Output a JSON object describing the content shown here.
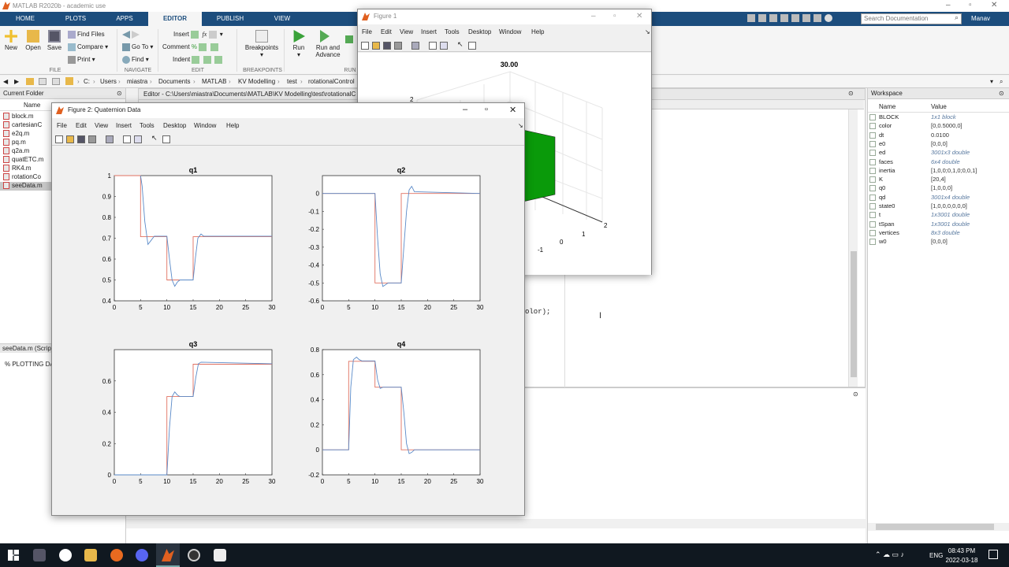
{
  "app": {
    "title": "MATLAB R2020b - academic use",
    "user": "Manav"
  },
  "ribbon": {
    "tabs": [
      "HOME",
      "PLOTS",
      "APPS",
      "EDITOR",
      "PUBLISH",
      "VIEW"
    ],
    "active_tab": "EDITOR",
    "file": {
      "new": "New",
      "open": "Open",
      "save": "Save",
      "find_files": "Find Files",
      "compare": "Compare",
      "print": "Print",
      "group": "FILE"
    },
    "navigate": {
      "go_to": "Go To",
      "find": "Find",
      "group": "NAVIGATE"
    },
    "edit": {
      "insert": "Insert",
      "comment": "Comment",
      "indent": "Indent",
      "group": "EDIT"
    },
    "breakpoints": {
      "label": "Breakpoints",
      "group": "BREAKPOINTS"
    },
    "run": {
      "run": "Run",
      "run_advance_1": "Run and",
      "run_advance_2": "Advance",
      "group": "RUN"
    }
  },
  "search": {
    "placeholder": "Search Documentation"
  },
  "path": [
    "C:",
    "Users",
    "miastra",
    "Documents",
    "MATLAB",
    "KV Modelling",
    "test",
    "rotationalControl"
  ],
  "current_folder": {
    "title": "Current Folder",
    "col_name": "Name",
    "files": [
      "block.m",
      "cartesianC",
      "e2q.m",
      "pq.m",
      "q2a.m",
      "quatETC.m",
      "RK4.m",
      "rotationCo",
      "seeData.m"
    ],
    "selected": "seeData.m",
    "details": "seeData.m  (Script)",
    "details_text": "% PLOTTING DAT"
  },
  "editor": {
    "title": "Editor - C:\\Users\\miastra\\Documents\\MATLAB\\KV Modelling\\test\\rotationalC",
    "code_fragment": "olor);"
  },
  "workspace": {
    "title": "Workspace",
    "col_name": "Name",
    "col_value": "Value",
    "vars": [
      {
        "name": "BLOCK",
        "value": "1x1 block",
        "italic": true
      },
      {
        "name": "color",
        "value": "[0,0.5000,0]",
        "italic": false
      },
      {
        "name": "dt",
        "value": "0.0100",
        "italic": false
      },
      {
        "name": "e0",
        "value": "[0,0,0]",
        "italic": false
      },
      {
        "name": "ed",
        "value": "3001x3 double",
        "italic": true
      },
      {
        "name": "faces",
        "value": "6x4 double",
        "italic": true
      },
      {
        "name": "inertia",
        "value": "[1,0,0;0,1,0;0,0,1]",
        "italic": false
      },
      {
        "name": "K",
        "value": "[20,4]",
        "italic": false
      },
      {
        "name": "q0",
        "value": "[1,0,0,0]",
        "italic": false
      },
      {
        "name": "qd",
        "value": "3001x4 double",
        "italic": true
      },
      {
        "name": "state0",
        "value": "[1,0,0,0,0,0,0]",
        "italic": false
      },
      {
        "name": "t",
        "value": "1x3001 double",
        "italic": true
      },
      {
        "name": "tSpan",
        "value": "1x3001 double",
        "italic": true
      },
      {
        "name": "vertices",
        "value": "8x3 double",
        "italic": true
      },
      {
        "name": "w0",
        "value": "[0,0,0]",
        "italic": false
      }
    ]
  },
  "figure1": {
    "title": "Figure 1",
    "menu": [
      "File",
      "Edit",
      "View",
      "Insert",
      "Tools",
      "Desktop",
      "Window",
      "Help"
    ],
    "plot_title": "30.00",
    "axis_labels": [
      "2",
      "2",
      "1",
      "0",
      "-1"
    ]
  },
  "figure2": {
    "title": "Figure 2: Quaternion Data",
    "menu": [
      "File",
      "Edit",
      "View",
      "Insert",
      "Tools",
      "Desktop",
      "Window",
      "Help"
    ]
  },
  "taskbar": {
    "lang": "ENG",
    "time": "08:43 PM",
    "date": "2022-03-18"
  },
  "chart_data": [
    {
      "type": "line",
      "title": "q1",
      "xlabel": "",
      "ylabel": "",
      "xlim": [
        0,
        30
      ],
      "ylim": [
        0.4,
        1
      ],
      "xticks": [
        0,
        5,
        10,
        15,
        20,
        25,
        30
      ],
      "yticks": [
        0.4,
        0.5,
        0.6,
        0.7,
        0.8,
        0.9,
        1
      ],
      "ytick_labels": [
        "0.4",
        "0.5",
        "0.6",
        "0.7",
        "0.8",
        "0.9",
        "1"
      ],
      "series": [
        {
          "color": "#e07060",
          "x": [
            0,
            5,
            5,
            10,
            10,
            15,
            15,
            30
          ],
          "y": [
            1,
            1,
            0.7071,
            0.7071,
            0.5,
            0.5,
            0.7071,
            0.7071
          ]
        },
        {
          "color": "#5a8ac8",
          "x": [
            5,
            5.3,
            5.8,
            6.4,
            7,
            7.6,
            10,
            10.5,
            11,
            11.5,
            12,
            12.5,
            15,
            15.4,
            15.9,
            16.5,
            17,
            30
          ],
          "y": [
            1,
            0.95,
            0.78,
            0.67,
            0.69,
            0.71,
            0.71,
            0.6,
            0.5,
            0.47,
            0.49,
            0.5,
            0.5,
            0.6,
            0.7,
            0.72,
            0.71,
            0.71
          ]
        }
      ]
    },
    {
      "type": "line",
      "title": "q2",
      "xlabel": "",
      "ylabel": "",
      "xlim": [
        0,
        30
      ],
      "ylim": [
        -0.6,
        0.1
      ],
      "xticks": [
        0,
        5,
        10,
        15,
        20,
        25,
        30
      ],
      "yticks": [
        -0.6,
        -0.5,
        -0.4,
        -0.3,
        -0.2,
        -0.1,
        0
      ],
      "ytick_labels": [
        "-0.6",
        "-0.5",
        "-0.4",
        "-0.3",
        "-0.2",
        "-0.1",
        "0"
      ],
      "series": [
        {
          "color": "#e07060",
          "x": [
            0,
            10,
            10,
            15,
            15,
            30
          ],
          "y": [
            0,
            0,
            -0.5,
            -0.5,
            0,
            0
          ]
        },
        {
          "color": "#5a8ac8",
          "x": [
            0,
            10,
            10.5,
            11,
            11.5,
            12,
            12.5,
            15,
            15.5,
            16,
            16.5,
            17,
            17.5,
            30
          ],
          "y": [
            0,
            0,
            -0.25,
            -0.45,
            -0.52,
            -0.51,
            -0.5,
            -0.5,
            -0.3,
            -0.1,
            0.02,
            0.04,
            0.01,
            0
          ]
        }
      ]
    },
    {
      "type": "line",
      "title": "q3",
      "xlabel": "",
      "ylabel": "",
      "xlim": [
        0,
        30
      ],
      "ylim": [
        0,
        0.8
      ],
      "xticks": [
        0,
        5,
        10,
        15,
        20,
        25,
        30
      ],
      "yticks": [
        0,
        0.2,
        0.4,
        0.6
      ],
      "ytick_labels": [
        "0",
        "0.2",
        "0.4",
        "0.6"
      ],
      "series": [
        {
          "color": "#e07060",
          "x": [
            0,
            10,
            10,
            15,
            15,
            30
          ],
          "y": [
            0,
            0,
            0.5,
            0.5,
            0.7071,
            0.7071
          ]
        },
        {
          "color": "#5a8ac8",
          "x": [
            0,
            10,
            10.5,
            11,
            11.5,
            12,
            12.5,
            15,
            15.5,
            16,
            16.5,
            30
          ],
          "y": [
            0,
            0,
            0.3,
            0.5,
            0.53,
            0.51,
            0.5,
            0.5,
            0.62,
            0.71,
            0.72,
            0.71
          ]
        }
      ]
    },
    {
      "type": "line",
      "title": "q4",
      "xlabel": "",
      "ylabel": "",
      "xlim": [
        0,
        30
      ],
      "ylim": [
        -0.2,
        0.8
      ],
      "xticks": [
        0,
        5,
        10,
        15,
        20,
        25,
        30
      ],
      "yticks": [
        -0.2,
        0,
        0.2,
        0.4,
        0.6,
        0.8
      ],
      "ytick_labels": [
        "-0.2",
        "0",
        "0.2",
        "0.4",
        "0.6",
        "0.8"
      ],
      "series": [
        {
          "color": "#e07060",
          "x": [
            0,
            5,
            5,
            10,
            10,
            15,
            15,
            30
          ],
          "y": [
            0,
            0,
            0.7071,
            0.7071,
            0.5,
            0.5,
            0,
            0
          ]
        },
        {
          "color": "#5a8ac8",
          "x": [
            0,
            5,
            5.4,
            5.9,
            6.5,
            7,
            7.5,
            10,
            10.5,
            11,
            11.5,
            12,
            15,
            15.5,
            16,
            16.5,
            17,
            17.5,
            30
          ],
          "y": [
            0,
            0,
            0.5,
            0.72,
            0.74,
            0.72,
            0.71,
            0.71,
            0.56,
            0.49,
            0.5,
            0.5,
            0.5,
            0.3,
            0.05,
            -0.03,
            -0.02,
            0,
            0
          ]
        }
      ]
    }
  ]
}
